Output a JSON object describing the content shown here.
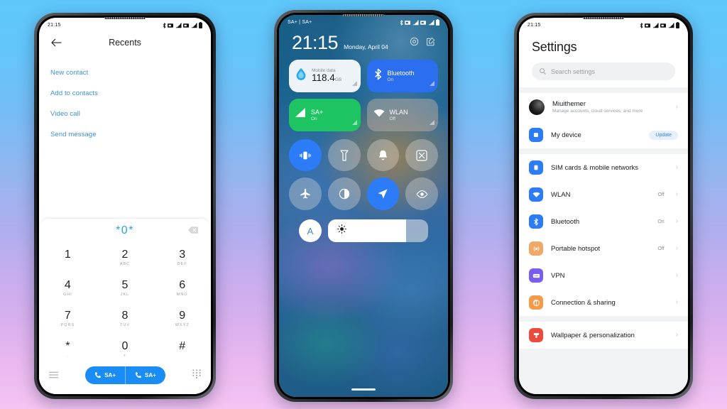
{
  "background": {
    "top_color": "#5fc8fb",
    "bottom_color": "#f5c4f2"
  },
  "phone_dialer": {
    "status_bar": {
      "time": "21:15",
      "icons": [
        "bluetooth-icon",
        "sim-icon",
        "signal-icon",
        "sim-icon",
        "signal-icon",
        "battery-icon"
      ]
    },
    "appbar": {
      "back_icon": "back-arrow-icon",
      "title": "Recents"
    },
    "actions": [
      {
        "label": "New contact"
      },
      {
        "label": "Add to contacts"
      },
      {
        "label": "Video call"
      },
      {
        "label": "Send message"
      }
    ],
    "dialpad": {
      "number": "*0*",
      "delete_icon": "backspace-icon",
      "keys": [
        {
          "digit": "1",
          "letters": ""
        },
        {
          "digit": "2",
          "letters": "ABC"
        },
        {
          "digit": "3",
          "letters": "DEF"
        },
        {
          "digit": "4",
          "letters": "GHI"
        },
        {
          "digit": "5",
          "letters": "JKL"
        },
        {
          "digit": "6",
          "letters": "MNO"
        },
        {
          "digit": "7",
          "letters": "PQRS"
        },
        {
          "digit": "8",
          "letters": "TUV"
        },
        {
          "digit": "9",
          "letters": "WXYZ"
        },
        {
          "digit": "*",
          "letters": ","
        },
        {
          "digit": "0",
          "letters": "+"
        },
        {
          "digit": "#",
          "letters": ""
        }
      ]
    },
    "bottom_bar": {
      "menu_icon": "hamburger-menu-icon",
      "keypad_icon": "keypad-icon",
      "call_buttons": [
        {
          "icon": "phone-icon",
          "label": "SA+"
        },
        {
          "icon": "phone-icon",
          "label": "SA+"
        }
      ],
      "accent": "#1a8cf5"
    }
  },
  "phone_control_center": {
    "status_bar": {
      "carrier": "SA+ | SA+",
      "icons": [
        "bluetooth-icon",
        "sim-icon",
        "signal-icon",
        "sim-icon",
        "signal-icon",
        "battery-icon"
      ]
    },
    "header": {
      "time": "21:15",
      "date": "Monday, April 04",
      "settings_icon": "gear-icon",
      "edit_icon": "edit-icon"
    },
    "big_tiles": [
      {
        "name": "mobile-data",
        "label": "Mobile data",
        "value": "118.4",
        "unit": "GB",
        "icon": "water-drop-icon",
        "state": "active",
        "color": "#ffffff"
      },
      {
        "name": "bluetooth",
        "label": "Bluetooth",
        "state_label": "On",
        "icon": "bluetooth-icon",
        "color": "#2b6ef0"
      },
      {
        "name": "mobile-network",
        "label": "SA+",
        "state_label": "On",
        "icon": "signal-bars-icon",
        "color": "#1fc462"
      },
      {
        "name": "wlan",
        "label": "WLAN",
        "state_label": "Off",
        "icon": "wifi-icon",
        "color": "#bcb0a6"
      }
    ],
    "toggles": [
      {
        "name": "vibrate",
        "icon": "vibrate-icon",
        "on": true
      },
      {
        "name": "flashlight",
        "icon": "flashlight-icon",
        "on": false
      },
      {
        "name": "ringtone",
        "icon": "bell-icon",
        "on": false
      },
      {
        "name": "screenshot",
        "icon": "screenshot-icon",
        "on": false
      },
      {
        "name": "airplane-mode",
        "icon": "airplane-icon",
        "on": false
      },
      {
        "name": "dark-mode",
        "icon": "contrast-icon",
        "on": false
      },
      {
        "name": "location",
        "icon": "location-arrow-icon",
        "on": true
      },
      {
        "name": "reading-mode",
        "icon": "eye-icon",
        "on": false
      }
    ],
    "brightness": {
      "auto_label": "A",
      "icon": "sun-icon",
      "level": 78
    },
    "home_indicator": true
  },
  "phone_settings": {
    "status_bar": {
      "time": "21:15",
      "icons": [
        "bluetooth-icon",
        "sim-icon",
        "signal-icon",
        "sim-icon",
        "signal-icon",
        "battery-icon"
      ]
    },
    "title": "Settings",
    "search": {
      "placeholder": "Search settings",
      "icon": "search-icon"
    },
    "account_card": [
      {
        "name": "account",
        "icon": "avatar",
        "label": "Miuithemer",
        "sub": "Manage accounts, cloud services, and more",
        "chevron": "chevron-right-icon"
      },
      {
        "name": "my-device",
        "icon": "device-icon",
        "icon_color": "#2b7cf6",
        "label": "My device",
        "badge": "Update"
      }
    ],
    "network_card": [
      {
        "name": "sim-cards",
        "icon": "sim-icon",
        "icon_color": "#2b7cf6",
        "label": "SIM cards & mobile networks",
        "value": ""
      },
      {
        "name": "wlan",
        "icon": "wifi-icon",
        "icon_color": "#2b7cf6",
        "label": "WLAN",
        "value": "Off"
      },
      {
        "name": "bluetooth",
        "icon": "bluetooth-icon",
        "icon_color": "#2b7cf6",
        "label": "Bluetooth",
        "value": "On"
      },
      {
        "name": "portable-hotspot",
        "icon": "hotspot-icon",
        "icon_color": "#f0a868",
        "label": "Portable hotspot",
        "value": "Off"
      },
      {
        "name": "vpn",
        "icon": "vpn-icon",
        "icon_color": "#7a5cf0",
        "label": "VPN",
        "value": ""
      },
      {
        "name": "connection-sharing",
        "icon": "sharing-icon",
        "icon_color": "#f59a4b",
        "label": "Connection & sharing",
        "value": ""
      }
    ],
    "personalization_card": [
      {
        "name": "wallpaper",
        "icon": "brush-icon",
        "icon_color": "#ea4b3c",
        "label": "Wallpaper & personalization",
        "value": ""
      }
    ]
  }
}
